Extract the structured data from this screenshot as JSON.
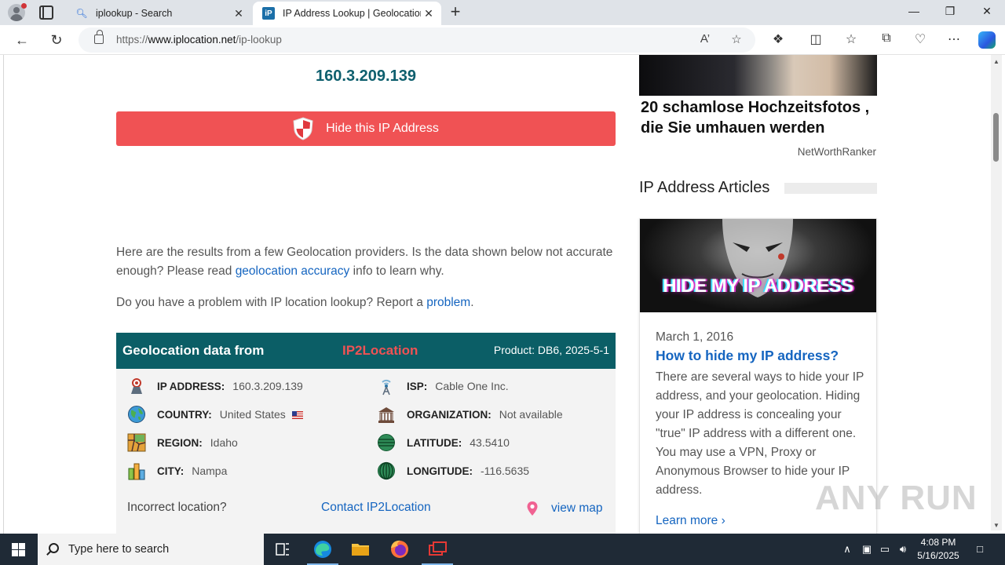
{
  "browser": {
    "tabs": [
      {
        "title": "iplookup - Search",
        "icon": "search-icon"
      },
      {
        "title": "IP Address Lookup | Geolocation",
        "icon": "iplocation-favicon"
      }
    ],
    "new_tab_symbol": "+",
    "url_prefix": "https://",
    "url_host": "www.iplocation.net",
    "url_path": "/ip-lookup"
  },
  "main": {
    "ip_heading": "160.3.209.139",
    "hide_button": "Hide this IP Address",
    "intro_before": "Here are the results from a few Geolocation providers. Is the data shown below not accurate enough? Please read ",
    "intro_link": "geolocation accuracy",
    "intro_after": " info to learn why.",
    "report_before": "Do you have a problem with IP location lookup? Report a ",
    "report_link": "problem",
    "report_after": "."
  },
  "geo": {
    "title": "Geolocation data from",
    "provider": "IP2Location",
    "product": "Product: DB6, 2025-5-1",
    "left": [
      {
        "label": "IP ADDRESS:",
        "value": "160.3.209.139"
      },
      {
        "label": "COUNTRY:",
        "value": "United States"
      },
      {
        "label": "REGION:",
        "value": "Idaho"
      },
      {
        "label": "CITY:",
        "value": "Nampa"
      }
    ],
    "right": [
      {
        "label": "ISP:",
        "value": "Cable One Inc."
      },
      {
        "label": "ORGANIZATION:",
        "value": "Not available"
      },
      {
        "label": "LATITUDE:",
        "value": "43.5410"
      },
      {
        "label": "LONGITUDE:",
        "value": "-116.5635"
      }
    ],
    "incorrect": "Incorrect location?",
    "contact": "Contact IP2Location",
    "view_map": "view map"
  },
  "sidebar": {
    "ad_headline": "20 schamlose Hochzeitsfotos , die Sie umhauen werden",
    "ad_source": "NetWorthRanker",
    "articles_heading": "IP Address Articles",
    "card": {
      "image_text": "HIDE MY IP ADDRESS",
      "date": "March 1, 2016",
      "title": "How to hide my IP address?",
      "text": "There are several ways to hide your IP address, and your geolocation. Hiding your IP address is concealing your \"true\" IP address with a different one. You may use a VPN, Proxy or Anonymous Browser to hide your IP address.",
      "more": "Learn more"
    }
  },
  "watermark": "ANY RUN",
  "taskbar": {
    "search_placeholder": "Type here to search",
    "time": "4:08 PM",
    "date": "5/16/2025"
  },
  "colors": {
    "accent_teal": "#0b5e66",
    "button_red": "#f05254",
    "link_blue": "#1565c0"
  }
}
